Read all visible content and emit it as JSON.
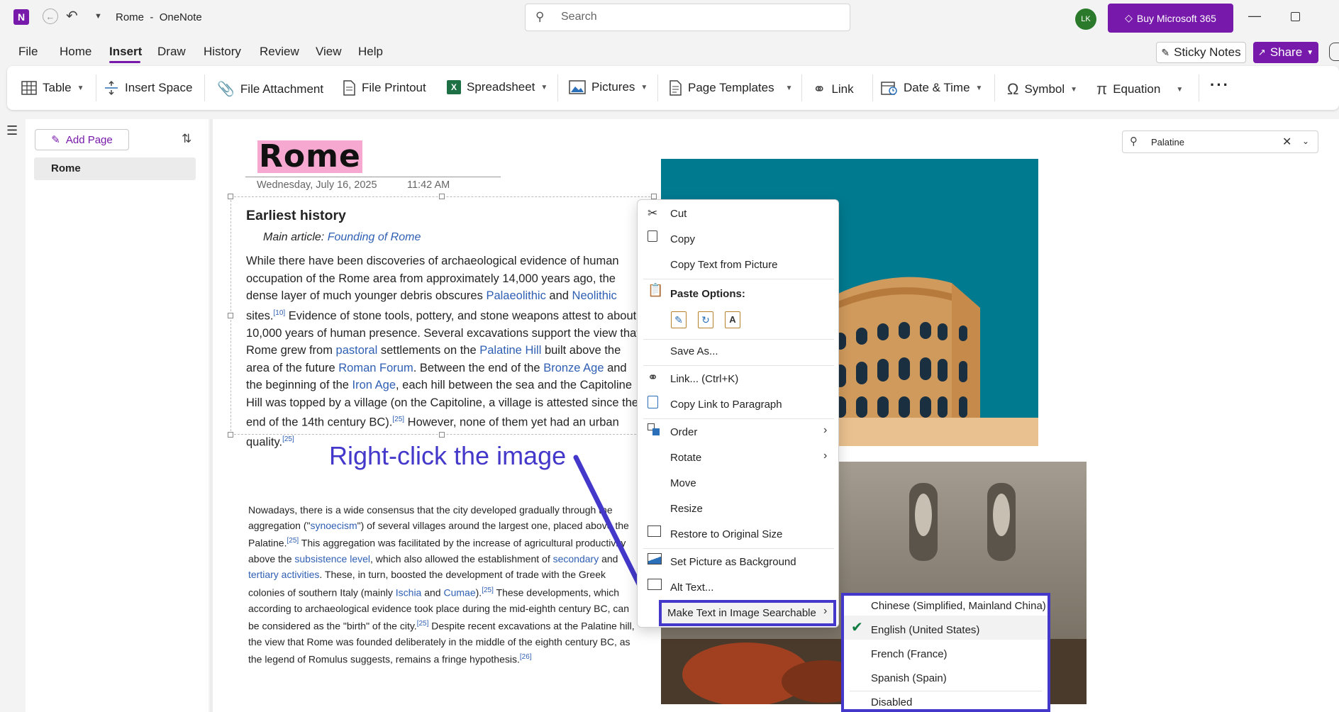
{
  "app": {
    "title": "Rome",
    "app_name": "OneNote",
    "separator": "-"
  },
  "search": {
    "placeholder": "Search"
  },
  "account": {
    "initials": "LK",
    "buy_label": "Buy Microsoft 365"
  },
  "menu": {
    "tabs": [
      "File",
      "Home",
      "Insert",
      "Draw",
      "History",
      "Review",
      "View",
      "Help"
    ],
    "active": "Insert",
    "sticky_notes": "Sticky Notes",
    "share": "Share"
  },
  "ribbon": {
    "table": "Table",
    "insert_space": "Insert Space",
    "file_attachment": "File Attachment",
    "file_printout": "File Printout",
    "spreadsheet": "Spreadsheet",
    "pictures": "Pictures",
    "page_templates": "Page Templates",
    "link": "Link",
    "date_time": "Date & Time",
    "symbol": "Symbol",
    "equation": "Equation",
    "more": "···"
  },
  "pages": {
    "add_page": "Add Page",
    "items": [
      "Rome"
    ]
  },
  "find": {
    "value": "Palatine"
  },
  "page": {
    "title": "Rome",
    "date": "Wednesday, July 16, 2025",
    "time": "11:42 AM",
    "heading": "Earliest history",
    "main_article_prefix": "Main article: ",
    "main_article_link": "Founding of Rome",
    "callout": "Right-click the image"
  },
  "context_menu": {
    "cut": "Cut",
    "copy": "Copy",
    "copy_text": "Copy Text from Picture",
    "paste_options": "Paste Options:",
    "save_as": "Save As...",
    "link": "Link...  (Ctrl+K)",
    "copy_link": "Copy Link to Paragraph",
    "order": "Order",
    "rotate": "Rotate",
    "move": "Move",
    "resize": "Resize",
    "restore": "Restore to Original Size",
    "set_background": "Set Picture as Background",
    "alt_text": "Alt Text...",
    "make_searchable": "Make Text in Image Searchable"
  },
  "submenu": {
    "items": [
      "Chinese (Simplified, Mainland China)",
      "English (United States)",
      "French (France)",
      "Spanish (Spain)",
      "Disabled"
    ],
    "checked": "English (United States)"
  },
  "colors": {
    "accent": "#7719aa",
    "link": "#2f5fb3",
    "callout": "#4338ca",
    "highlight": "#f7a8d0",
    "teal": "#007a8f"
  }
}
